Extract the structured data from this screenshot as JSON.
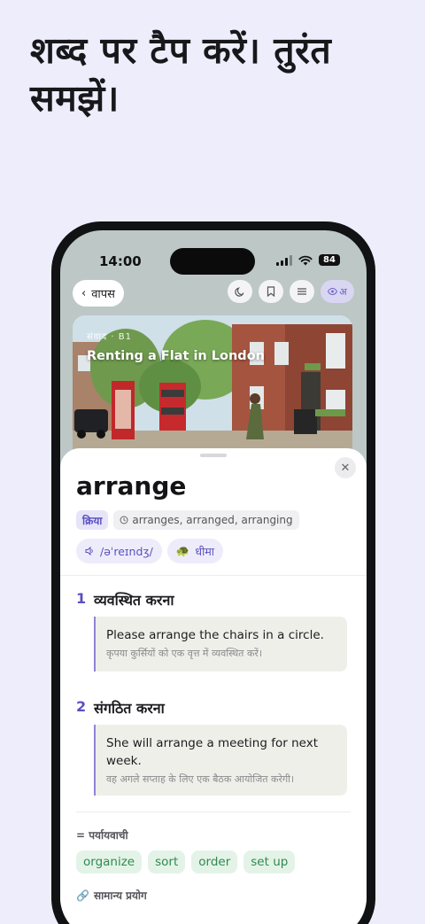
{
  "headline": "शब्द पर टैप करें। तुरंत समझें।",
  "status": {
    "time": "14:00",
    "battery": "84"
  },
  "nav": {
    "back_label": "वापस",
    "lang_label": "अ"
  },
  "hero": {
    "meta": "संवाद · B1",
    "title": "Renting a Flat in London"
  },
  "entry": {
    "word": "arrange",
    "pos": "क्रिया",
    "forms": "arranges, arranged, arranging",
    "ipa": "/əˈreɪndʒ/",
    "speed": "धीमा",
    "senses": [
      {
        "num": "1",
        "definition": "व्यवस्थित करना",
        "example_en": "Please arrange the chairs in a circle.",
        "example_hi": "कृपया कुर्सियों को एक वृत्त में व्यवस्थित करें।"
      },
      {
        "num": "2",
        "definition": "संगठित करना",
        "example_en": "She will arrange a meeting for next week.",
        "example_hi": "वह अगले सप्ताह के लिए एक बैठक आयोजित करेगी।"
      }
    ],
    "synonyms_title": "= पर्यायवाची",
    "synonyms": [
      "organize",
      "sort",
      "order",
      "set up"
    ],
    "usage_title": "सामान्य प्रयोग"
  },
  "colors": {
    "accent": "#5b4fc0",
    "background": "#eeedfb",
    "synonym_text": "#2f8a4e"
  }
}
